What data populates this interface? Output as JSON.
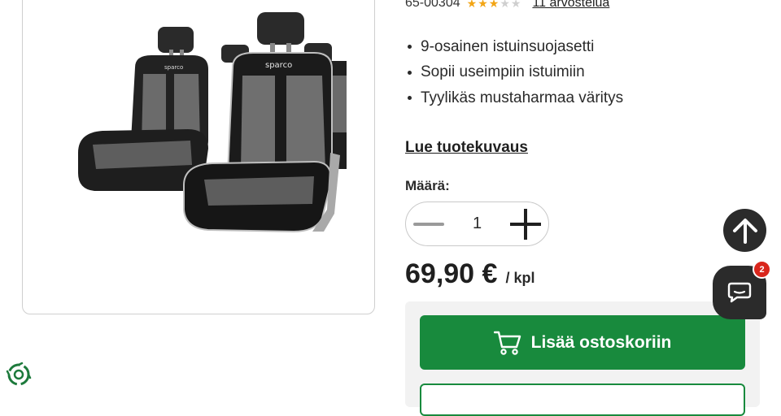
{
  "product": {
    "sku": "65-00304",
    "rating": 3,
    "rating_max": 5,
    "reviews_label": "11 arvostelua",
    "features": [
      "9-osainen istuinsuojasetti",
      "Sopii useimpiin istuimiin",
      "Tyylikäs mustaharmaa väritys"
    ],
    "image_brand_text": "sparco",
    "description_link": "Lue tuotekuvaus"
  },
  "quantity": {
    "label": "Määrä:",
    "value": "1"
  },
  "price": {
    "amount": "69,90 €",
    "unit": "/ kpl"
  },
  "cart": {
    "add_label": "Lisää ostoskoriin"
  },
  "chat": {
    "badge_count": "2"
  },
  "colors": {
    "accent_green": "#188a3d",
    "star": "#f2a516",
    "dark_button": "#2b2b2b",
    "badge_red": "#d9261c"
  },
  "icons": [
    "cart-icon",
    "minus-icon",
    "plus-icon",
    "arrow-up-icon",
    "chat-icon",
    "eco-icon",
    "star-icon"
  ]
}
